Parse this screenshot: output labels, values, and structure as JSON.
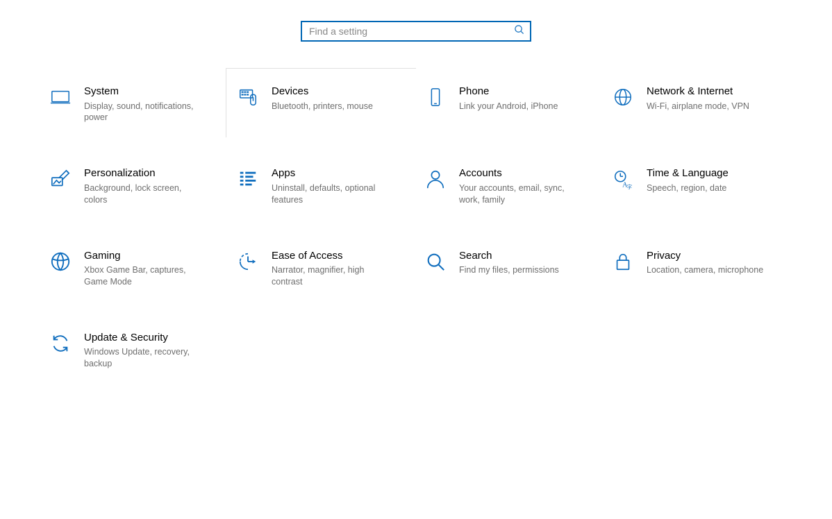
{
  "accent": "#106ebe",
  "search": {
    "placeholder": "Find a setting"
  },
  "tiles": [
    {
      "id": "system",
      "title": "System",
      "desc": "Display, sound, notifications, power"
    },
    {
      "id": "devices",
      "title": "Devices",
      "desc": "Bluetooth, printers, mouse",
      "focused": true
    },
    {
      "id": "phone",
      "title": "Phone",
      "desc": "Link your Android, iPhone"
    },
    {
      "id": "network",
      "title": "Network & Internet",
      "desc": "Wi-Fi, airplane mode, VPN"
    },
    {
      "id": "personalization",
      "title": "Personalization",
      "desc": "Background, lock screen, colors"
    },
    {
      "id": "apps",
      "title": "Apps",
      "desc": "Uninstall, defaults, optional features"
    },
    {
      "id": "accounts",
      "title": "Accounts",
      "desc": "Your accounts, email, sync, work, family"
    },
    {
      "id": "time",
      "title": "Time & Language",
      "desc": "Speech, region, date"
    },
    {
      "id": "gaming",
      "title": "Gaming",
      "desc": "Xbox Game Bar, captures, Game Mode"
    },
    {
      "id": "ease",
      "title": "Ease of Access",
      "desc": "Narrator, magnifier, high contrast"
    },
    {
      "id": "search",
      "title": "Search",
      "desc": "Find my files, permissions"
    },
    {
      "id": "privacy",
      "title": "Privacy",
      "desc": "Location, camera, microphone"
    },
    {
      "id": "update",
      "title": "Update & Security",
      "desc": "Windows Update, recovery, backup"
    }
  ]
}
